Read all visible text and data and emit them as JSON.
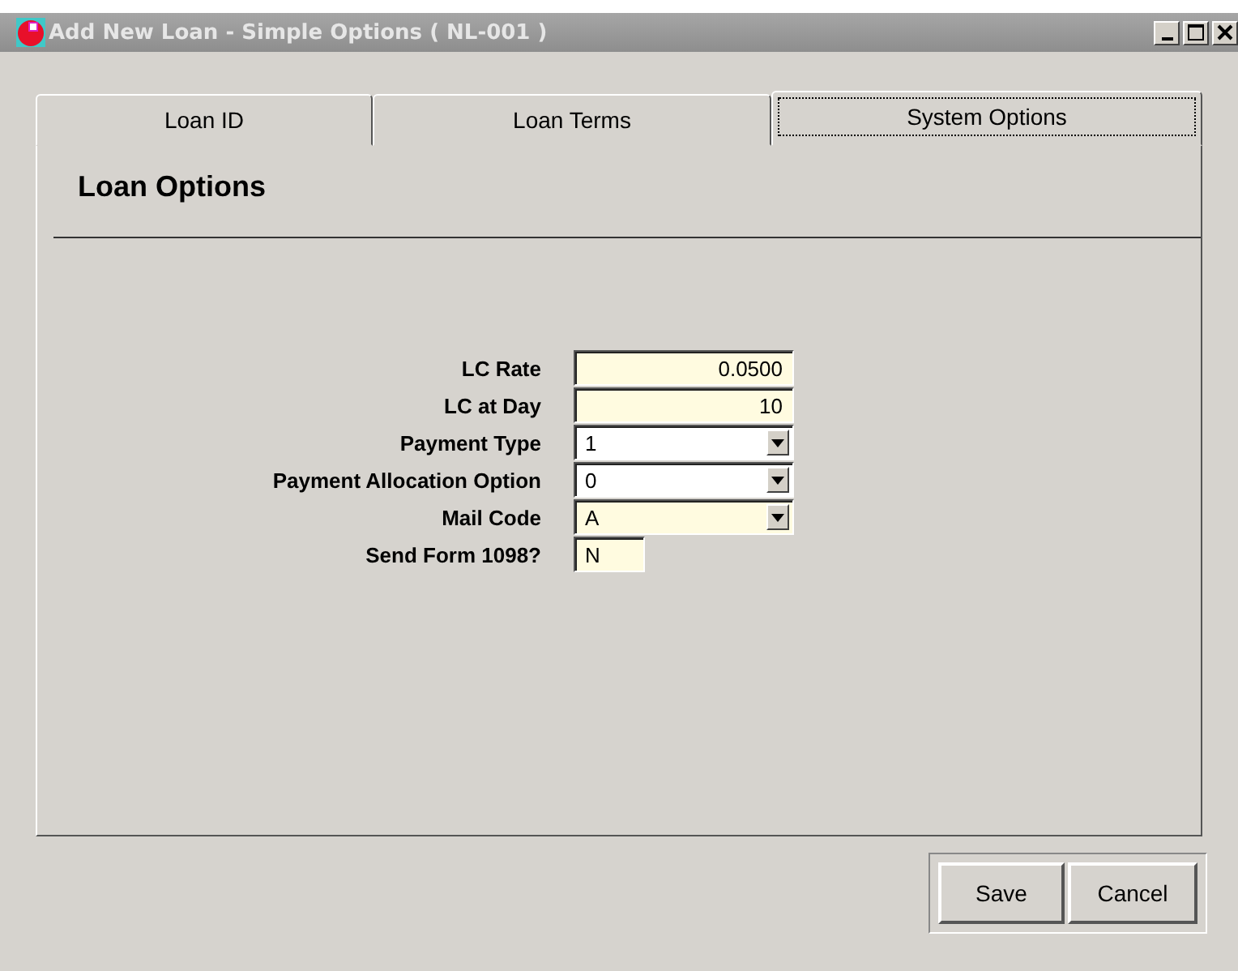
{
  "window": {
    "title": "Add New Loan - Simple Options ( NL-001 )"
  },
  "tabs": [
    {
      "label": "Loan ID",
      "selected": false
    },
    {
      "label": "Loan Terms",
      "selected": false
    },
    {
      "label": "System Options",
      "selected": true
    }
  ],
  "section_title": "Loan Options",
  "fields": [
    {
      "label": "LC Rate",
      "kind": "number",
      "value": "0.0500",
      "highlighted": true
    },
    {
      "label": "LC at Day",
      "kind": "number",
      "value": "10",
      "highlighted": true
    },
    {
      "label": "Payment Type",
      "kind": "dropdown",
      "value": "1",
      "highlighted": false
    },
    {
      "label": "Payment Allocation Option",
      "kind": "dropdown",
      "value": "0",
      "highlighted": false
    },
    {
      "label": "Mail Code",
      "kind": "dropdown",
      "value": "A",
      "highlighted": true
    },
    {
      "label": "Send Form 1098?",
      "kind": "code",
      "value": "N",
      "highlighted": true
    }
  ],
  "buttons": [
    "Save",
    "Cancel"
  ]
}
